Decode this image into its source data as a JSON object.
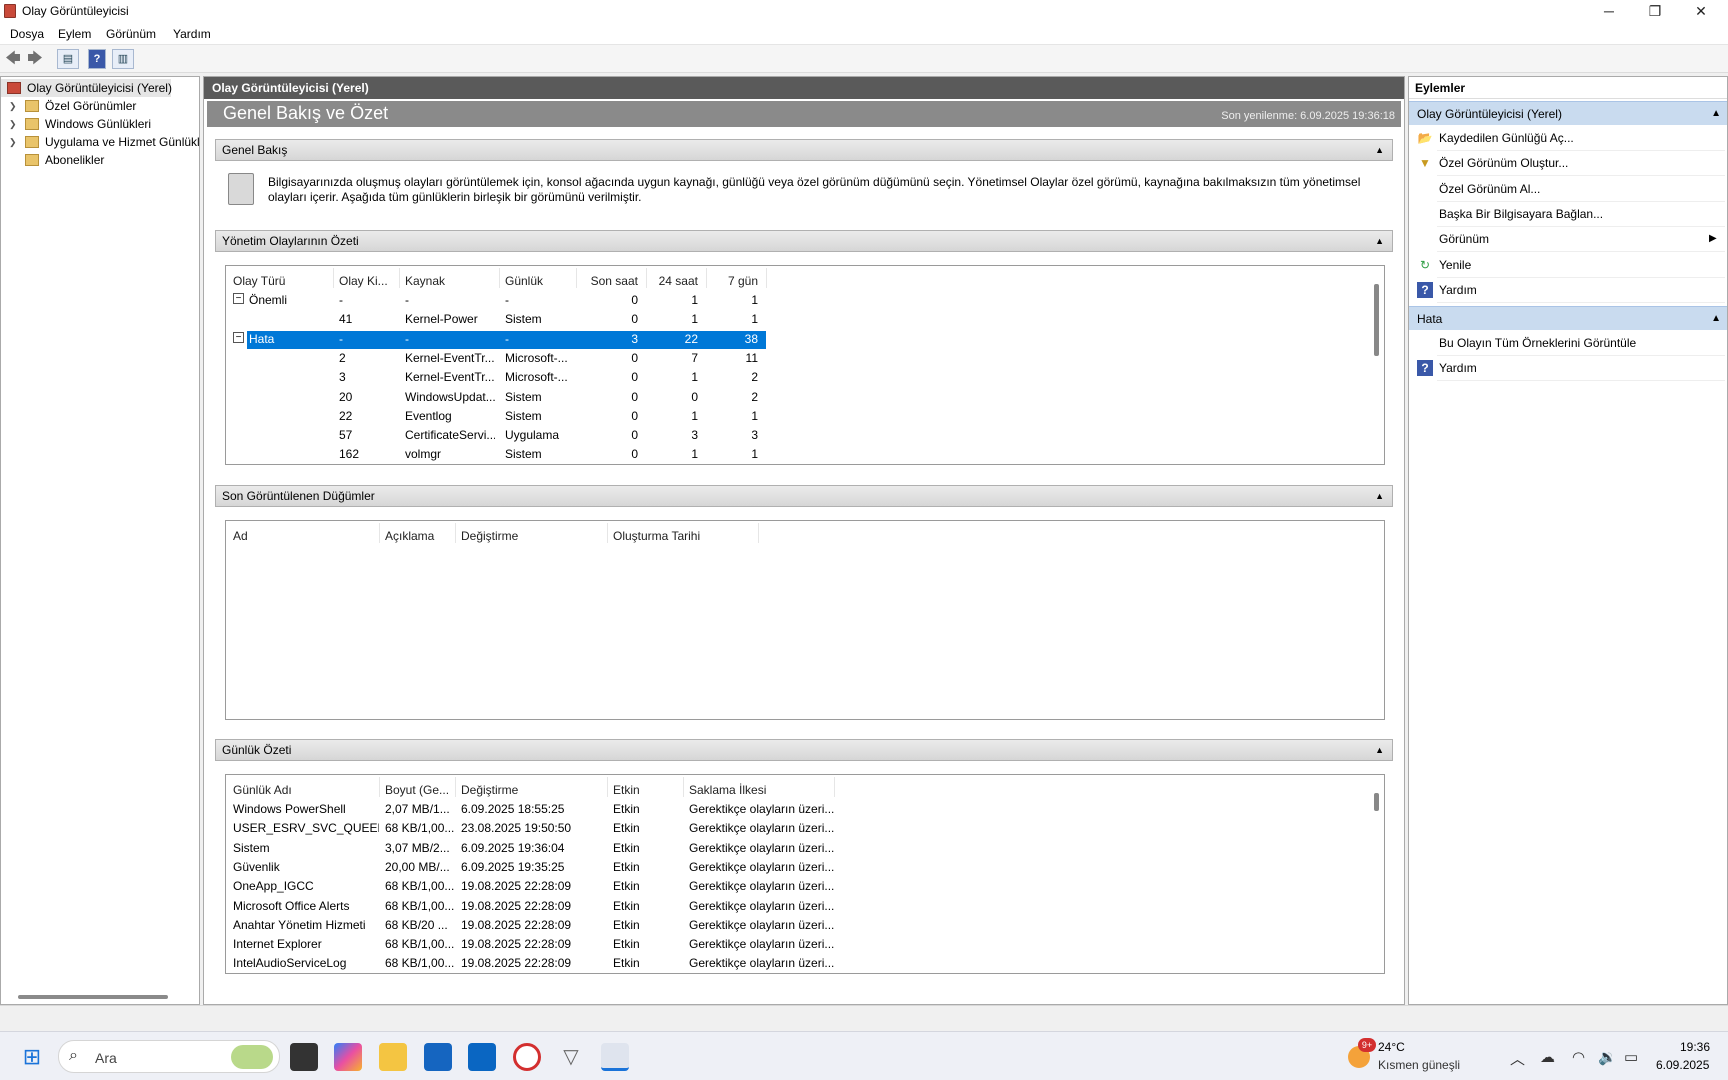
{
  "window": {
    "title": "Olay Görüntüleyicisi",
    "minimize": "─",
    "maximize": "❐",
    "close": "✕"
  },
  "menu": [
    "Dosya",
    "Eylem",
    "Görünüm",
    "Yardım"
  ],
  "toolbar": {
    "back": "🡄",
    "forward": "🡆",
    "help": "?"
  },
  "tree": {
    "items": [
      {
        "label": "Olay Görüntüleyicisi (Yerel)",
        "expander": ""
      },
      {
        "label": "Özel Görünümler",
        "expander": "❯"
      },
      {
        "label": "Windows Günlükleri",
        "expander": "❯"
      },
      {
        "label": "Uygulama ve Hizmet Günlükleri",
        "expander": "❯"
      },
      {
        "label": "Abonelikler",
        "expander": ""
      }
    ]
  },
  "center": {
    "header": "Olay Görüntüleyicisi (Yerel)",
    "banner_title": "Genel Bakış ve Özet",
    "banner_refresh": "Son yenilenme: 6.09.2025 19:36:18",
    "overview": {
      "title": "Genel Bakış",
      "text": "Bilgisayarınızda oluşmuş olayları görüntülemek için, konsol ağacında uygun kaynağı, günlüğü veya özel görünüm düğümünü seçin. Yönetimsel Olaylar özel görümü, kaynağına bakılmaksızın tüm yönetimsel olayları içerir. Aşağıda tüm günlüklerin birleşik bir görümünü verilmiştir."
    },
    "summary": {
      "title": "Yönetim Olaylarının Özeti",
      "columns": [
        "Olay Türü",
        "Olay Ki...",
        "Kaynak",
        "Günlük",
        "Son saat",
        "24 saat",
        "7 gün"
      ],
      "rows": [
        {
          "type": "Önemli",
          "id": "-",
          "source": "-",
          "log": "-",
          "hour": "0",
          "day": "1",
          "week": "1",
          "group": true,
          "selected": false
        },
        {
          "type": "",
          "id": "41",
          "source": "Kernel-Power",
          "log": "Sistem",
          "hour": "0",
          "day": "1",
          "week": "1",
          "group": false,
          "selected": false
        },
        {
          "type": "Hata",
          "id": "-",
          "source": "-",
          "log": "-",
          "hour": "3",
          "day": "22",
          "week": "38",
          "group": true,
          "selected": true
        },
        {
          "type": "",
          "id": "2",
          "source": "Kernel-EventTr...",
          "log": "Microsoft-...",
          "hour": "0",
          "day": "7",
          "week": "11",
          "group": false,
          "selected": false
        },
        {
          "type": "",
          "id": "3",
          "source": "Kernel-EventTr...",
          "log": "Microsoft-...",
          "hour": "0",
          "day": "1",
          "week": "2",
          "group": false,
          "selected": false
        },
        {
          "type": "",
          "id": "20",
          "source": "WindowsUpdat...",
          "log": "Sistem",
          "hour": "0",
          "day": "0",
          "week": "2",
          "group": false,
          "selected": false
        },
        {
          "type": "",
          "id": "22",
          "source": "Eventlog",
          "log": "Sistem",
          "hour": "0",
          "day": "1",
          "week": "1",
          "group": false,
          "selected": false
        },
        {
          "type": "",
          "id": "57",
          "source": "CertificateServi...",
          "log": "Uygulama",
          "hour": "0",
          "day": "3",
          "week": "3",
          "group": false,
          "selected": false
        },
        {
          "type": "",
          "id": "162",
          "source": "volmgr",
          "log": "Sistem",
          "hour": "0",
          "day": "1",
          "week": "1",
          "group": false,
          "selected": false
        }
      ]
    },
    "recent": {
      "title": "Son Görüntülenen Düğümler",
      "columns": [
        "Ad",
        "Açıklama",
        "Değiştirme",
        "Oluşturma Tarihi"
      ]
    },
    "logsummary": {
      "title": "Günlük Özeti",
      "columns": [
        "Günlük Adı",
        "Boyut (Ge...",
        "Değiştirme",
        "Etkin",
        "Saklama İlkesi"
      ],
      "rows": [
        [
          "Windows PowerShell",
          "2,07 MB/1...",
          "6.09.2025 18:55:25",
          "Etkin",
          "Gerektikçe olayların üzeri..."
        ],
        [
          "USER_ESRV_SVC_QUEENC...",
          "68 KB/1,00...",
          "23.08.2025 19:50:50",
          "Etkin",
          "Gerektikçe olayların üzeri..."
        ],
        [
          "Sistem",
          "3,07 MB/2...",
          "6.09.2025 19:36:04",
          "Etkin",
          "Gerektikçe olayların üzeri..."
        ],
        [
          "Güvenlik",
          "20,00 MB/...",
          "6.09.2025 19:35:25",
          "Etkin",
          "Gerektikçe olayların üzeri..."
        ],
        [
          "OneApp_IGCC",
          "68 KB/1,00...",
          "19.08.2025 22:28:09",
          "Etkin",
          "Gerektikçe olayların üzeri..."
        ],
        [
          "Microsoft Office Alerts",
          "68 KB/1,00...",
          "19.08.2025 22:28:09",
          "Etkin",
          "Gerektikçe olayların üzeri..."
        ],
        [
          "Anahtar Yönetim Hizmeti",
          "68 KB/20 ...",
          "19.08.2025 22:28:09",
          "Etkin",
          "Gerektikçe olayların üzeri..."
        ],
        [
          "Internet Explorer",
          "68 KB/1,00...",
          "19.08.2025 22:28:09",
          "Etkin",
          "Gerektikçe olayların üzeri..."
        ],
        [
          "IntelAudioServiceLog",
          "68 KB/1,00...",
          "19.08.2025 22:28:09",
          "Etkin",
          "Gerektikçe olayların üzeri..."
        ]
      ]
    }
  },
  "actions": {
    "title": "Eylemler",
    "section1": {
      "title": "Olay Görüntüleyicisi (Yerel)",
      "items": [
        {
          "label": "Kaydedilen Günlüğü Aç...",
          "icon": "📂",
          "color": "#d9a42a"
        },
        {
          "label": "Özel Görünüm Oluştur...",
          "icon": "▼",
          "color": "#c89a20"
        },
        {
          "label": "Özel Görünüm Al...",
          "icon": "",
          "color": ""
        },
        {
          "label": "Başka Bir Bilgisayara Bağlan...",
          "icon": "",
          "color": ""
        },
        {
          "label": "Görünüm",
          "icon": "",
          "color": "",
          "submenu": "▶"
        },
        {
          "label": "Yenile",
          "icon": "↻",
          "color": "#2f9e44"
        },
        {
          "label": "Yardım",
          "icon": "?",
          "color": "#3a58a8"
        }
      ]
    },
    "section2": {
      "title": "Hata",
      "items": [
        {
          "label": "Bu Olayın Tüm Örneklerini Görüntüle",
          "icon": "",
          "color": ""
        },
        {
          "label": "Yardım",
          "icon": "?",
          "color": "#3a58a8"
        }
      ]
    }
  },
  "taskbar": {
    "search_placeholder": "Ara",
    "weather_temp": "24°C",
    "weather_desc": "Kısmen güneşli",
    "badge": "9+",
    "time": "19:36",
    "date": "6.09.2025"
  },
  "colors": {
    "selection": "#0078d7",
    "section_header": "#c9dbef",
    "center_header": "#5a5a5a"
  }
}
